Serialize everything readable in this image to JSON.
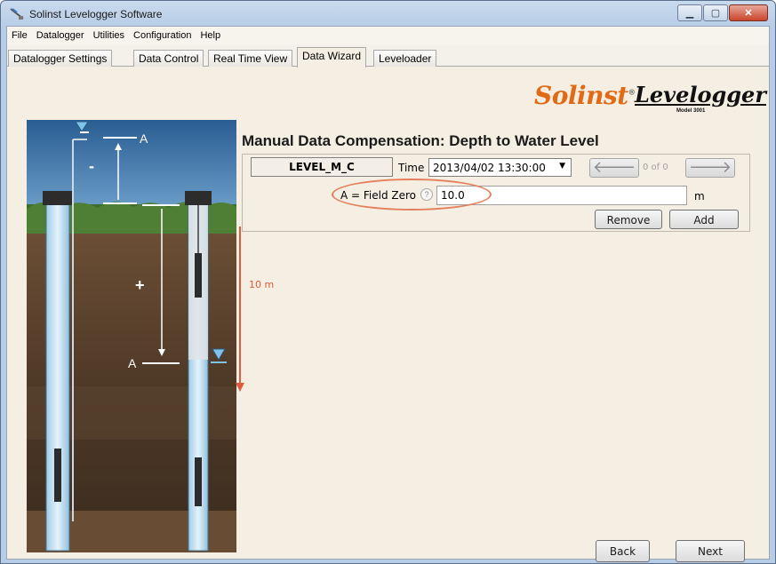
{
  "window": {
    "title": "Solinst Levelogger Software",
    "controls": {
      "minimize": "▁",
      "maximize": "▢",
      "close": "✕"
    }
  },
  "menu": [
    "File",
    "Datalogger",
    "Utilities",
    "Configuration",
    "Help"
  ],
  "tabs": [
    {
      "label": "Datalogger Settings",
      "active": false
    },
    {
      "label": "Data Control",
      "active": false
    },
    {
      "label": "Real Time View",
      "active": false
    },
    {
      "label": "Data Wizard",
      "active": true
    },
    {
      "label": "Leveloader",
      "active": false
    }
  ],
  "branding": {
    "solinst": "Solinst",
    "levelogger": "Levelogger",
    "model": "Model 3001"
  },
  "illustration": {
    "top_label": "A",
    "minus": "-",
    "plus": "+",
    "bottom_label": "A"
  },
  "form": {
    "title": "Manual Data Compensation: Depth to Water Level",
    "logger_name": "LEVEL_M_C",
    "time_label": "Time",
    "time_value": "2013/04/02 13:30:00",
    "prev_icon": "arrow-left-icon",
    "next_icon": "arrow-right-icon",
    "count": "0 of 0",
    "field_zero_label": "A = Field Zero",
    "help_glyph": "?",
    "field_zero_value": "10.0",
    "unit": "m",
    "remove_label": "Remove",
    "add_label": "Add"
  },
  "depth_annotation": "10 m",
  "footer": {
    "back_label": "Back",
    "next_label": "Next"
  },
  "colors": {
    "accent_red": "#e05a3c",
    "solinst_orange": "#e36a14",
    "panel_bg": "#f5efe3"
  }
}
